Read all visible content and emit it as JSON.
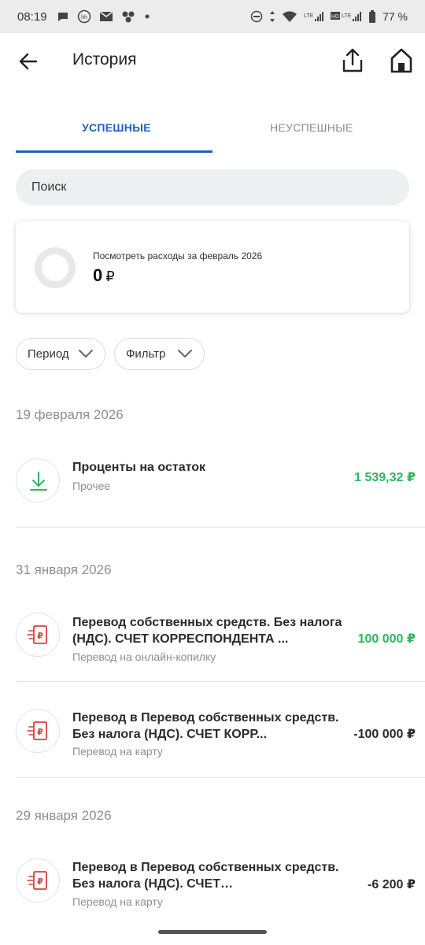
{
  "status_bar": {
    "time": "08:19",
    "battery": "77 %",
    "left_icons": [
      "chat-icon",
      "hh-icon",
      "mail-icon",
      "apps-icon",
      "dot-icon"
    ],
    "right_icons": [
      "dnd-icon",
      "data-arrows-icon",
      "wifi-icon",
      "lte-signal-icon",
      "hd-lte-signal-icon",
      "battery-icon"
    ]
  },
  "app_bar": {
    "title": "История",
    "icons": [
      "back-arrow-icon",
      "share-icon",
      "home-icon"
    ]
  },
  "tabs": [
    {
      "label": "УСПЕШНЫЕ",
      "active": true
    },
    {
      "label": "НЕУСПЕШНЫЕ",
      "active": false
    }
  ],
  "search": {
    "placeholder": "Поиск"
  },
  "summary": {
    "label": "Посмотреть расходы за февраль 2026",
    "amount": "0",
    "currency": "₽"
  },
  "chips": [
    {
      "label": "Период"
    },
    {
      "label": "Фильтр"
    }
  ],
  "groups": [
    {
      "date": "19 февраля 2026",
      "transactions": [
        {
          "title": "Проценты на остаток",
          "subtitle": "Прочее",
          "amount": "1 539,32 ₽",
          "type": "income",
          "icon": "download-icon"
        }
      ]
    },
    {
      "date": "31 января 2026",
      "transactions": [
        {
          "title": "Перевод собственных средств. Без налога (НДС). СЧЕТ КОРРЕСПОНДЕНТА ...",
          "subtitle": "Перевод на онлайн-копилку",
          "amount": "100 000 ₽",
          "type": "income",
          "icon": "ruble-document-icon"
        },
        {
          "title": "Перевод в Перевод собственных средств. Без налога (НДС). СЧЕТ КОРР...",
          "subtitle": "Перевод на карту",
          "amount": "-100 000 ₽",
          "type": "expense",
          "icon": "ruble-document-icon"
        }
      ]
    },
    {
      "date": "29 января 2026",
      "transactions": [
        {
          "title": "Перевод в Перевод собственных средств. Без налога (НДС). СЧЕТ КОРРЕСПОНДЕНТ...",
          "subtitle": "Перевод на карту",
          "amount": "-6 200 ₽",
          "type": "expense",
          "icon": "ruble-document-icon"
        }
      ]
    }
  ],
  "colors": {
    "accent": "#1e5fc4",
    "income": "#2fb561",
    "brand_icon": "#d7423b"
  }
}
